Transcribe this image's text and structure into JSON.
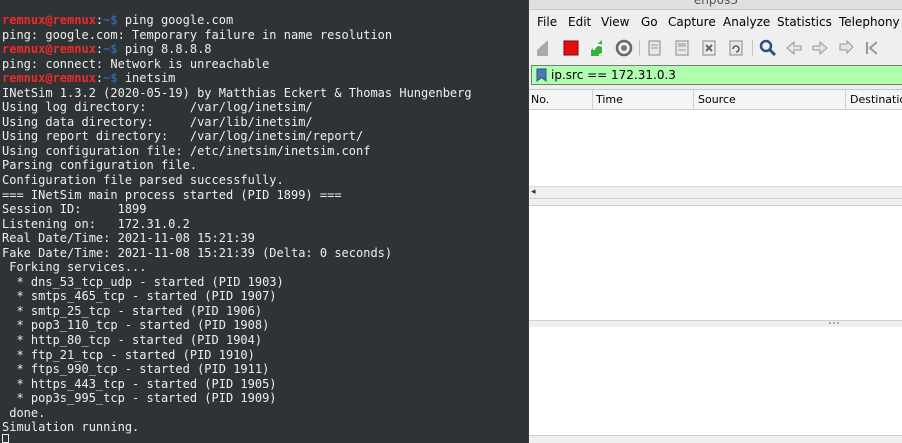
{
  "terminal": {
    "prompt_user": "remnux@remnux",
    "prompt_sep": ":",
    "prompt_path": "~$",
    "lines": [
      {
        "prompt": true,
        "cmd": " ping google.com"
      },
      {
        "text": "ping: google.com: Temporary failure in name resolution"
      },
      {
        "prompt": true,
        "cmd": " ping 8.8.8.8"
      },
      {
        "text": "ping: connect: Network is unreachable"
      },
      {
        "prompt": true,
        "cmd": " inetsim"
      },
      {
        "text": "INetSim 1.3.2 (2020-05-19) by Matthias Eckert & Thomas Hungenberg"
      },
      {
        "text": "Using log directory:      /var/log/inetsim/"
      },
      {
        "text": "Using data directory:     /var/lib/inetsim/"
      },
      {
        "text": "Using report directory:   /var/log/inetsim/report/"
      },
      {
        "text": "Using configuration file: /etc/inetsim/inetsim.conf"
      },
      {
        "text": "Parsing configuration file."
      },
      {
        "text": "Configuration file parsed successfully."
      },
      {
        "text": "=== INetSim main process started (PID 1899) ==="
      },
      {
        "text": "Session ID:     1899"
      },
      {
        "text": "Listening on:   172.31.0.2"
      },
      {
        "text": "Real Date/Time: 2021-11-08 15:21:39"
      },
      {
        "text": "Fake Date/Time: 2021-11-08 15:21:39 (Delta: 0 seconds)"
      },
      {
        "text": " Forking services..."
      },
      {
        "text": "  * dns_53_tcp_udp - started (PID 1903)"
      },
      {
        "text": "  * smtps_465_tcp - started (PID 1907)"
      },
      {
        "text": "  * smtp_25_tcp - started (PID 1906)"
      },
      {
        "text": "  * pop3_110_tcp - started (PID 1908)"
      },
      {
        "text": "  * http_80_tcp - started (PID 1904)"
      },
      {
        "text": "  * ftp_21_tcp - started (PID 1910)"
      },
      {
        "text": "  * ftps_990_tcp - started (PID 1911)"
      },
      {
        "text": "  * https_443_tcp - started (PID 1905)"
      },
      {
        "text": "  * pop3s_995_tcp - started (PID 1909)"
      },
      {
        "text": " done."
      },
      {
        "text": "Simulation running."
      }
    ]
  },
  "wireshark": {
    "title": "enp0s3",
    "menu": [
      "File",
      "Edit",
      "View",
      "Go",
      "Capture",
      "Analyze",
      "Statistics",
      "Telephony"
    ],
    "filter": {
      "value": "ip.src == 172.31.0.3",
      "bg_color": "#afffaf"
    },
    "columns": [
      "No.",
      "Time",
      "Source",
      "Destination"
    ],
    "toolbar_icons": [
      "shark-fin-start-icon",
      "stop-capture-icon",
      "restart-capture-icon",
      "capture-options-icon",
      "open-file-icon",
      "save-file-icon",
      "close-file-icon",
      "reload-file-icon",
      "find-packet-icon",
      "go-back-icon",
      "go-forward-icon",
      "go-to-packet-icon",
      "go-first-icon"
    ]
  }
}
